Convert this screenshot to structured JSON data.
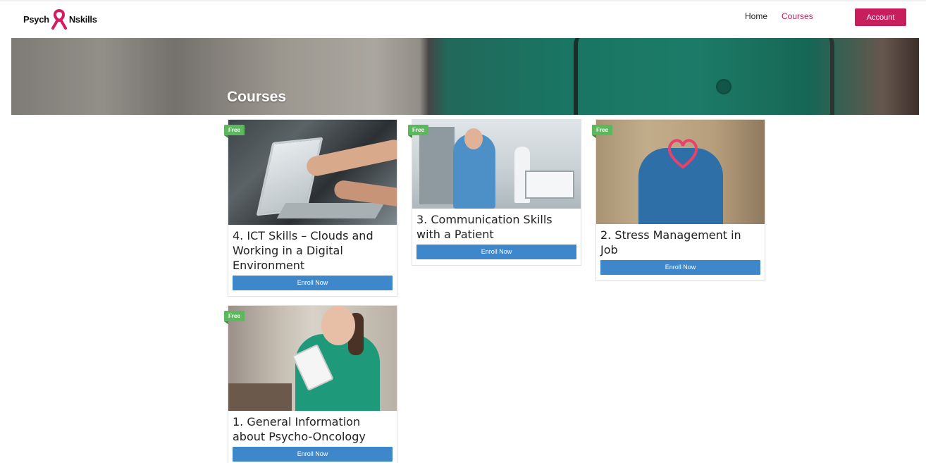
{
  "brand": {
    "logo_left": "Psych",
    "logo_right": "Nskills"
  },
  "nav": {
    "home": "Home",
    "courses": "Courses",
    "account": "Account"
  },
  "banner": {
    "title": "Courses"
  },
  "colors": {
    "accent": "#c81e5d",
    "enroll": "#3f87cb",
    "free_tag": "#5cb85c"
  },
  "courses": [
    {
      "tag": "Free",
      "title": "4. ICT Skills – Clouds and Working in a Digital Environment",
      "button": "Enroll Now"
    },
    {
      "tag": "Free",
      "title": "3. Communication Skills with a Patient",
      "button": "Enroll Now"
    },
    {
      "tag": "Free",
      "title": "2. Stress Management in Job",
      "button": "Enroll Now"
    },
    {
      "tag": "Free",
      "title": "1. General Information about Psycho-Oncology",
      "button": "Enroll Now"
    }
  ]
}
